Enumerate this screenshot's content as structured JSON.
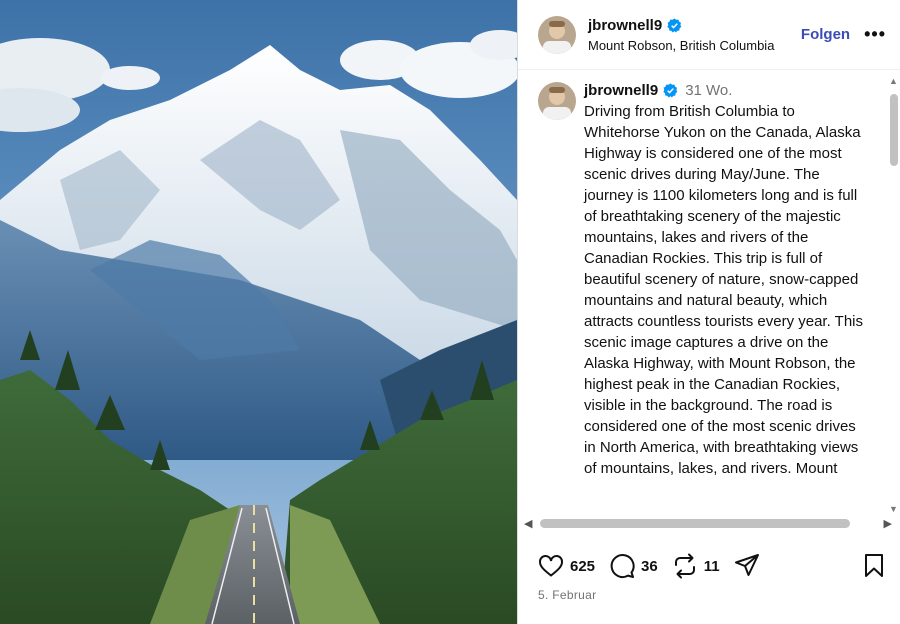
{
  "post": {
    "username": "jbrownell9",
    "location": "Mount Robson, British Columbia",
    "follow_label": "Folgen",
    "more_label": "•••"
  },
  "comment": {
    "username": "jbrownell9",
    "age": "31 Wo.",
    "text": "Driving from British Columbia to Whitehorse Yukon on the Canada, Alaska Highway is considered one of the most scenic drives during May/June. The journey is 1100 kilometers long and is full of breathtaking scenery of the majestic mountains, lakes and rivers of the Canadian Rockies. This trip is full of beautiful scenery of nature, snow-capped mountains and natural beauty, which attracts countless tourists every year.  This scenic image captures a drive on the Alaska Highway, with Mount Robson, the highest peak in the Canadian Rockies, visible in the background.  The road is considered one of the most scenic drives in North America, with breathtaking views of mountains, lakes, and rivers.  Mount"
  },
  "actions": {
    "likes": "625",
    "comments": "36",
    "reposts": "11"
  },
  "date": "5. Februar",
  "icons": {
    "verified": "verified-badge-icon",
    "like": "heart-icon",
    "comment": "comment-bubble-icon",
    "repost": "repost-icon",
    "share": "send-icon",
    "save": "bookmark-icon"
  },
  "colors": {
    "verified": "#0095f6",
    "follow": "#3b4cb8"
  }
}
